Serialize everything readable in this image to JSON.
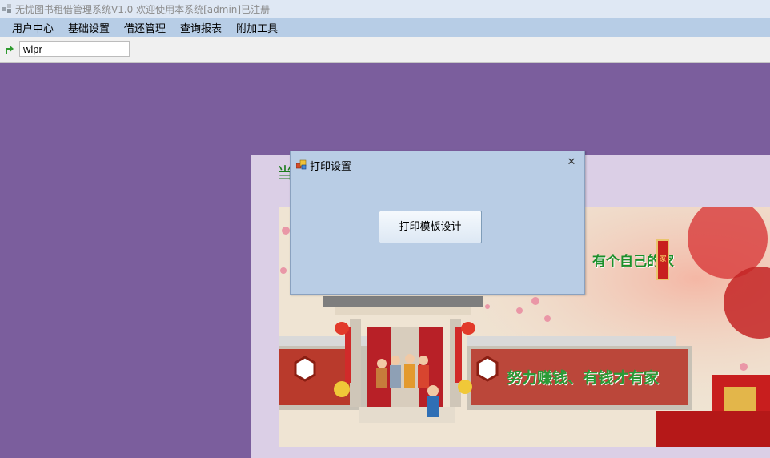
{
  "window": {
    "title": "无忧图书租借管理系统V1.0  欢迎使用本系统[admin]已注册"
  },
  "menu": {
    "items": [
      {
        "label": "用户中心"
      },
      {
        "label": "基础设置"
      },
      {
        "label": "借还管理"
      },
      {
        "label": "查询报表"
      },
      {
        "label": "附加工具"
      }
    ]
  },
  "toolbar": {
    "input_value": "wlpr",
    "arrow_icon": "green-turn-arrow-icon"
  },
  "panel": {
    "heading_fragment": "当",
    "banner": {
      "slogan_top": "有个自己的家",
      "slogan_bottom": "努力赚钱、有钱才有家",
      "seal_text": "家"
    }
  },
  "dialog": {
    "title": "打印设置",
    "button_label": "打印模板设计",
    "close_icon": "close-icon"
  },
  "colors": {
    "workspace": "#7b5e9d",
    "menubar": "#b7cde6",
    "dialog_bg": "#b9cde5",
    "panel_bg": "#dbcfe6"
  }
}
